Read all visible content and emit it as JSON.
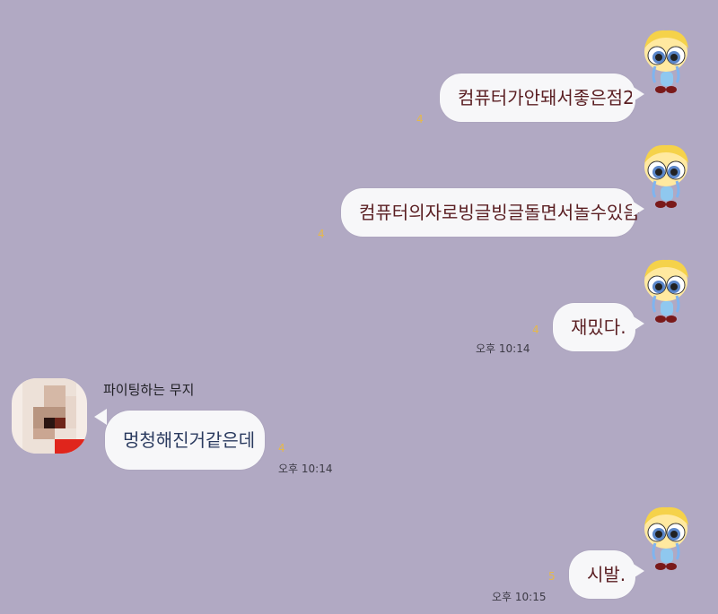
{
  "messages": [
    {
      "text": "컴퓨터가안돼서좋은점2",
      "unread": "4",
      "time": ""
    },
    {
      "text": "컴퓨터의자로빙글빙글돌면서놀수있음",
      "unread": "4",
      "time": ""
    },
    {
      "text": "재밌다.",
      "unread": "4",
      "time": "오후 10:14"
    },
    {
      "sender": "파이팅하는 무지",
      "text": "멍청해진거같은데",
      "unread": "4",
      "time": "오후 10:14"
    },
    {
      "text": "시발.",
      "unread": "5",
      "time": "오후 10:15"
    }
  ],
  "colors": {
    "background": "#b1a9c3",
    "bubble": "#f7f7f9",
    "unread": "#e6b94a"
  },
  "icons": {
    "my_avatar": "powerpuff-bubbles-crying-avatar",
    "other_avatar": "pixelated-profile-avatar"
  }
}
